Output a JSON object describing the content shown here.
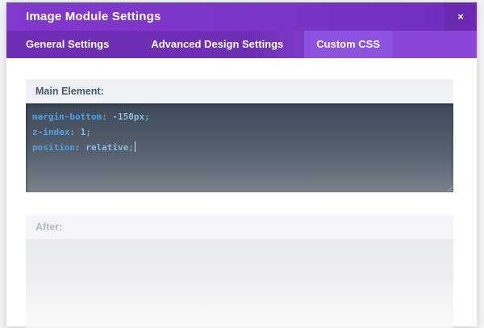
{
  "modal": {
    "title": "Image Module Settings",
    "close_icon": "×",
    "tabs": [
      {
        "label": "General Settings",
        "active": false
      },
      {
        "label": "Advanced Design Settings",
        "active": false
      },
      {
        "label": "Custom CSS",
        "active": true
      }
    ],
    "sections": {
      "main_element": {
        "label": "Main Element:",
        "code_lines": [
          [
            {
              "c": "prop",
              "t": "margin-bottom"
            },
            {
              "c": "pun",
              "t": ":"
            },
            {
              "c": "val",
              "t": " -150px"
            },
            {
              "c": "pun",
              "t": ";"
            }
          ],
          [
            {
              "c": "prop",
              "t": "z-index"
            },
            {
              "c": "pun",
              "t": ":"
            },
            {
              "c": "val",
              "t": " 1"
            },
            {
              "c": "pun",
              "t": ";"
            }
          ],
          [
            {
              "c": "prop",
              "t": "position"
            },
            {
              "c": "pun",
              "t": ":"
            },
            {
              "c": "val",
              "t": " relative"
            },
            {
              "c": "pun",
              "t": ";"
            }
          ]
        ],
        "cursor_visible": true
      },
      "after": {
        "label": "After:",
        "value": ""
      }
    }
  },
  "colors": {
    "header_purple": "#7a34c6",
    "tabbar_purple": "#6f2eb6",
    "tabbar_purple_right": "#8946d7",
    "active_tab_purple": "#8e52e2",
    "close_button_purple": "#6c2ab2",
    "option_label_bg": "#eef1f5",
    "option_label_text": "#4c5563",
    "editor_gradient_top": "#3c4959",
    "editor_gradient_bottom": "#7b828a",
    "code_property": "#55a0dd",
    "code_punctuation": "#8ba2b5",
    "code_value": "#94bbdd"
  }
}
